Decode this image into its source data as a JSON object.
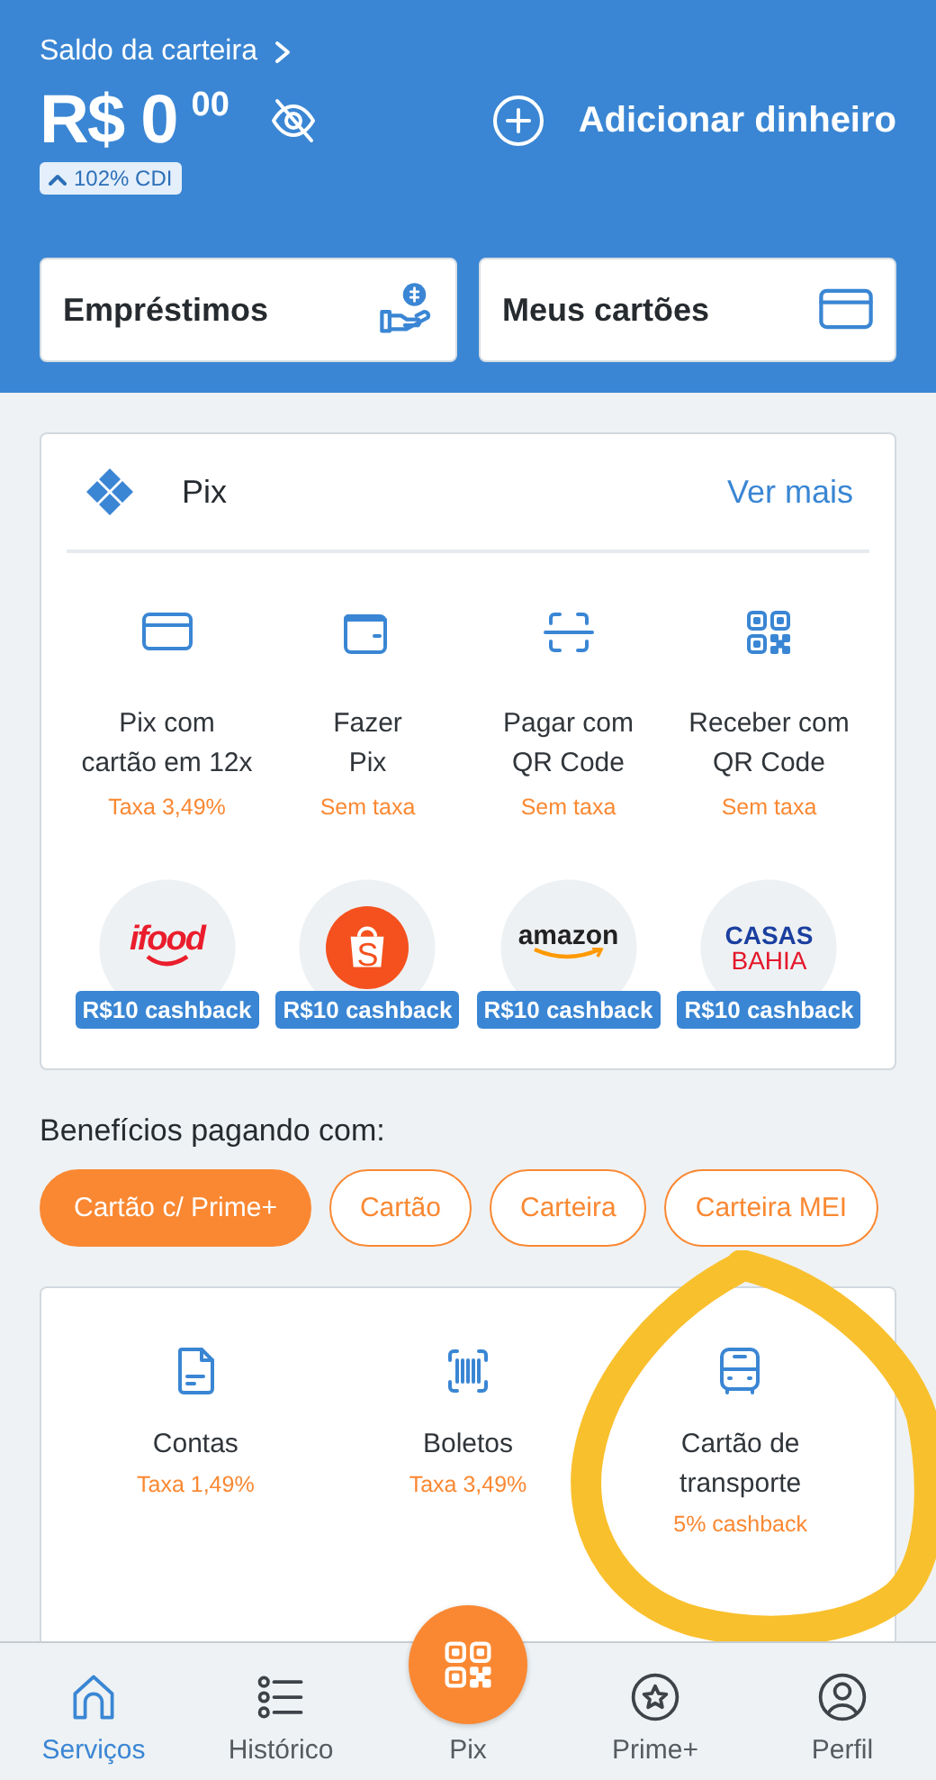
{
  "wallet": {
    "label": "Saldo da carteira",
    "currency": "R$",
    "amount": "0",
    "cents": "00",
    "yield_badge": "102% CDI",
    "add_money": "Adicionar dinheiro"
  },
  "shortcuts": [
    {
      "kind": "loan",
      "label": "Empréstimos"
    },
    {
      "kind": "card",
      "label": "Meus cartões"
    }
  ],
  "pix": {
    "title": "Pix",
    "more_link": "Ver mais",
    "actions": [
      {
        "kind": "card",
        "lines": [
          "Pix com",
          "cartão em 12x"
        ],
        "fee": "Taxa 3,49%"
      },
      {
        "kind": "wallet",
        "lines": [
          "Fazer",
          "Pix"
        ],
        "fee": "Sem taxa"
      },
      {
        "kind": "scan",
        "lines": [
          "Pagar com",
          "QR Code"
        ],
        "fee": "Sem taxa"
      },
      {
        "kind": "qr",
        "lines": [
          "Receber com",
          "QR Code"
        ],
        "fee": "Sem taxa"
      }
    ],
    "partners": [
      {
        "kind": "ifood",
        "logo_lines": [
          "ifood"
        ],
        "badge": "R$10 cashback"
      },
      {
        "kind": "shopee",
        "logo_lines": [
          "S"
        ],
        "badge": "R$10 cashback"
      },
      {
        "kind": "amazon",
        "logo_lines": [
          "amazon"
        ],
        "badge": "R$10 cashback"
      },
      {
        "kind": "casas",
        "logo_lines": [
          "CASAS",
          "BAHIA"
        ],
        "badge": "R$10 cashback"
      }
    ]
  },
  "benefits": {
    "title": "Benefícios pagando com:",
    "options": [
      {
        "label": "Cartão c/ Prime+",
        "selected": true
      },
      {
        "label": "Cartão",
        "selected": false
      },
      {
        "label": "Carteira",
        "selected": false
      },
      {
        "label": "Carteira MEI",
        "selected": false
      }
    ],
    "services": [
      {
        "kind": "bill",
        "lines": [
          "Contas"
        ],
        "fee": "Taxa 1,49%"
      },
      {
        "kind": "barcode",
        "lines": [
          "Boletos"
        ],
        "fee": "Taxa 3,49%"
      },
      {
        "kind": "bus",
        "lines": [
          "Cartão de",
          "transporte"
        ],
        "fee": "5% cashback"
      }
    ]
  },
  "annotation": {
    "kind": "circle"
  },
  "nav": [
    {
      "kind": "home",
      "label": "Serviços",
      "selected": true
    },
    {
      "kind": "list",
      "label": "Histórico",
      "selected": false
    },
    {
      "kind": "qr",
      "label": "Pix",
      "selected": false
    },
    {
      "kind": "star",
      "label": "Prime+",
      "selected": false
    },
    {
      "kind": "person",
      "label": "Perfil",
      "selected": false
    }
  ]
}
